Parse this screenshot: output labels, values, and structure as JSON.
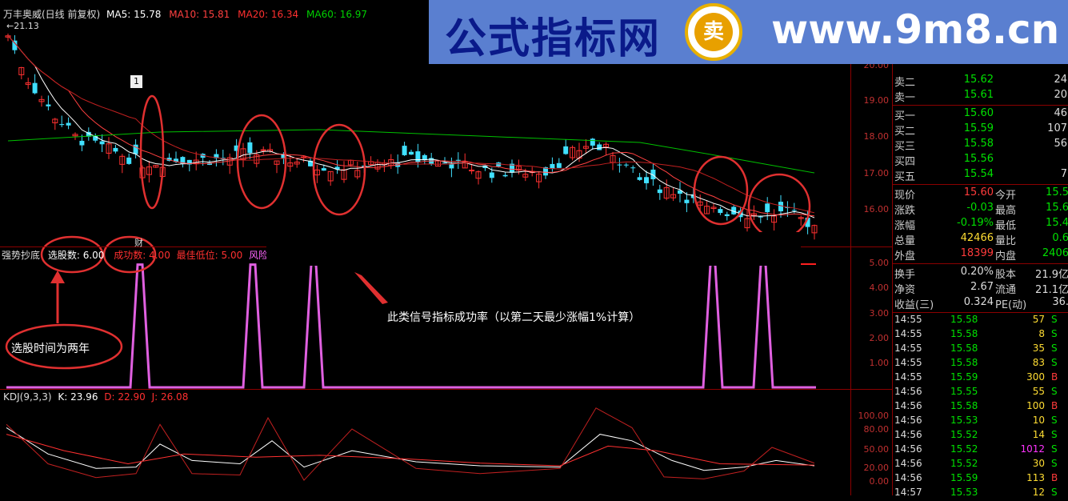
{
  "header": {
    "title": "万丰奥威(日线 前复权)",
    "ma5": "MA5: 15.78",
    "ma10": "MA10: 15.81",
    "ma20": "MA20: 16.34",
    "ma60": "MA60: 16.97",
    "high_marker": "21.13"
  },
  "colors": {
    "ma5": "#ffffff",
    "ma10": "#ff4040",
    "ma20": "#c02020",
    "ma60": "#00c000",
    "up": "#ff3030",
    "down": "#40e0ff",
    "signal": "#e060e0",
    "annotation": "#e03030"
  },
  "price_axis": [
    "20.00",
    "19.00",
    "18.00",
    "17.00",
    "16.00"
  ],
  "box_label": "1",
  "indicator": {
    "name": "强势抄底",
    "count_label": "选股数: 6.00",
    "success_label": "成功数: 4.00",
    "best_low_label": "最佳低位: 5.00",
    "risk_label": "风险控制:",
    "marker": "财",
    "axis": [
      "5.00",
      "4.00",
      "3.00",
      "2.00",
      "1.00"
    ]
  },
  "kdj": {
    "label": "KDJ(9,3,3)",
    "k": "K: 23.96",
    "d": "D: 22.90",
    "j": "J: 26.08",
    "axis": [
      "100.00",
      "80.00",
      "50.00",
      "20.00",
      "0.00"
    ]
  },
  "annotations": {
    "period_note": "选股时间为两年",
    "success_note": "此类信号指标成功率（以第二天最少涨幅1%计算）"
  },
  "banner": {
    "title": "公式指标网",
    "url": "www.9m8.cn",
    "logo_text": "卖"
  },
  "quote": {
    "asks": [
      {
        "label": "卖二",
        "price": "15.62",
        "vol": "24"
      },
      {
        "label": "卖一",
        "price": "15.61",
        "vol": "20"
      }
    ],
    "bids": [
      {
        "label": "买一",
        "price": "15.60",
        "vol": "46"
      },
      {
        "label": "买二",
        "price": "15.59",
        "vol": "107"
      },
      {
        "label": "买三",
        "price": "15.58",
        "vol": "56"
      },
      {
        "label": "买四",
        "price": "15.56",
        "vol": ""
      },
      {
        "label": "买五",
        "price": "15.54",
        "vol": "7"
      }
    ],
    "stats": [
      {
        "l1": "现价",
        "v1": "15.60",
        "c1": "red",
        "l2": "今开",
        "v2": "15.5",
        "c2": "green"
      },
      {
        "l1": "涨跌",
        "v1": "-0.03",
        "c1": "green",
        "l2": "最高",
        "v2": "15.6",
        "c2": "green"
      },
      {
        "l1": "涨幅",
        "v1": "-0.19%",
        "c1": "green",
        "l2": "最低",
        "v2": "15.4",
        "c2": "green"
      },
      {
        "l1": "总量",
        "v1": "42466",
        "c1": "yellow",
        "l2": "量比",
        "v2": "0.6",
        "c2": "green"
      },
      {
        "l1": "外盘",
        "v1": "18399",
        "c1": "red",
        "l2": "内盘",
        "v2": "2406",
        "c2": "green"
      }
    ],
    "fund": [
      {
        "l1": "换手",
        "v1": "0.20%",
        "l2": "股本",
        "v2": "21.9亿"
      },
      {
        "l1": "净资",
        "v1": "2.67",
        "l2": "流通",
        "v2": "21.1亿"
      },
      {
        "l1": "收益(三)",
        "v1": "0.324",
        "l2": "PE(动)",
        "v2": "36."
      }
    ],
    "ticks": [
      {
        "time": "14:55",
        "price": "15.58",
        "vol": "57",
        "side": "S"
      },
      {
        "time": "14:55",
        "price": "15.58",
        "vol": "8",
        "side": "S"
      },
      {
        "time": "14:55",
        "price": "15.58",
        "vol": "35",
        "side": "S"
      },
      {
        "time": "14:55",
        "price": "15.58",
        "vol": "83",
        "side": "S"
      },
      {
        "time": "14:55",
        "price": "15.59",
        "vol": "300",
        "side": "B"
      },
      {
        "time": "14:56",
        "price": "15.55",
        "vol": "55",
        "side": "S"
      },
      {
        "time": "14:56",
        "price": "15.58",
        "vol": "100",
        "side": "B"
      },
      {
        "time": "14:56",
        "price": "15.53",
        "vol": "10",
        "side": "S"
      },
      {
        "time": "14:56",
        "price": "15.52",
        "vol": "14",
        "side": "S"
      },
      {
        "time": "14:56",
        "price": "15.52",
        "vol": "1012",
        "side": "S"
      },
      {
        "time": "14:56",
        "price": "15.52",
        "vol": "30",
        "side": "S"
      },
      {
        "time": "14:56",
        "price": "15.59",
        "vol": "113",
        "side": "B"
      },
      {
        "time": "14:57",
        "price": "15.53",
        "vol": "12",
        "side": "S"
      }
    ]
  }
}
